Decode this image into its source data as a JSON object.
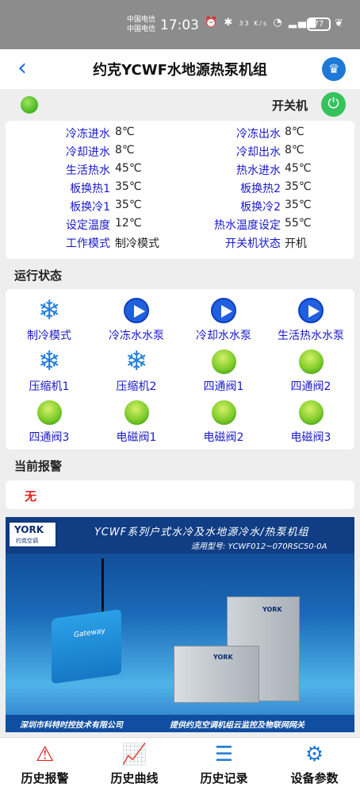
{
  "status_bar": {
    "carrier_1": "中国电信",
    "carrier_2": "中国电信",
    "time": "17:03",
    "net_speed": "33 K/s",
    "battery": "77"
  },
  "header": {
    "title": "约克YCWF水地源热泵机组"
  },
  "power": {
    "label": "开关机",
    "state_color": "#3daf1d"
  },
  "info_rows": [
    {
      "left_label": "冷冻进水",
      "left_value": "8℃",
      "right_label": "冷冻出水",
      "right_value": "8℃"
    },
    {
      "left_label": "冷却进水",
      "left_value": "8℃",
      "right_label": "冷却出水",
      "right_value": "8℃"
    },
    {
      "left_label": "生活热水",
      "left_value": "45℃",
      "right_label": "热水进水",
      "right_value": "45℃"
    },
    {
      "left_label": "板换热1",
      "left_value": "35℃",
      "right_label": "板换热2",
      "right_value": "35℃"
    },
    {
      "left_label": "板换冷1",
      "left_value": "35℃",
      "right_label": "板换冷2",
      "right_value": "35℃"
    },
    {
      "left_label": "设定温度",
      "left_value": "12℃",
      "right_label": "热水温度设定",
      "right_value": "55℃"
    },
    {
      "left_label": "工作模式",
      "left_value": "制冷模式",
      "right_label": "开关机状态",
      "right_value": "开机"
    }
  ],
  "run_status": {
    "title": "运行状态",
    "items": [
      {
        "label": "制冷模式",
        "icon": "snowflake-icon"
      },
      {
        "label": "冷冻水水泵",
        "icon": "play-icon"
      },
      {
        "label": "冷却水水泵",
        "icon": "play-icon"
      },
      {
        "label": "生活热水水泵",
        "icon": "play-icon"
      },
      {
        "label": "压缩机1",
        "icon": "snowflake-icon"
      },
      {
        "label": "压缩机2",
        "icon": "snowflake-icon"
      },
      {
        "label": "四通阀1",
        "icon": "green-dot-icon"
      },
      {
        "label": "四通阀2",
        "icon": "green-dot-icon"
      },
      {
        "label": "四通阀3",
        "icon": "green-dot-icon"
      },
      {
        "label": "电磁阀1",
        "icon": "green-dot-icon"
      },
      {
        "label": "电磁阀2",
        "icon": "green-dot-icon"
      },
      {
        "label": "电磁阀3",
        "icon": "green-dot-icon"
      }
    ]
  },
  "alarm": {
    "title": "当前报警",
    "value": "无"
  },
  "banner": {
    "logo_text": "YORK",
    "logo_sub": "约克空调",
    "headline": "YCWF系列户式水冷及水地源冷水/热泵机组",
    "model": "适用型号: YCWF012~070RSC50-0A",
    "gateway_label": "Gateway",
    "unit_logo": "YORK",
    "company": "深圳市科特时控技术有限公司",
    "service": "提供约克空调机组云监控及物联网网关"
  },
  "bottom_nav": [
    {
      "label": "历史报警",
      "icon": "warning-icon"
    },
    {
      "label": "历史曲线",
      "icon": "chart-icon"
    },
    {
      "label": "历史记录",
      "icon": "document-icon"
    },
    {
      "label": "设备参数",
      "icon": "gear-icon"
    }
  ]
}
